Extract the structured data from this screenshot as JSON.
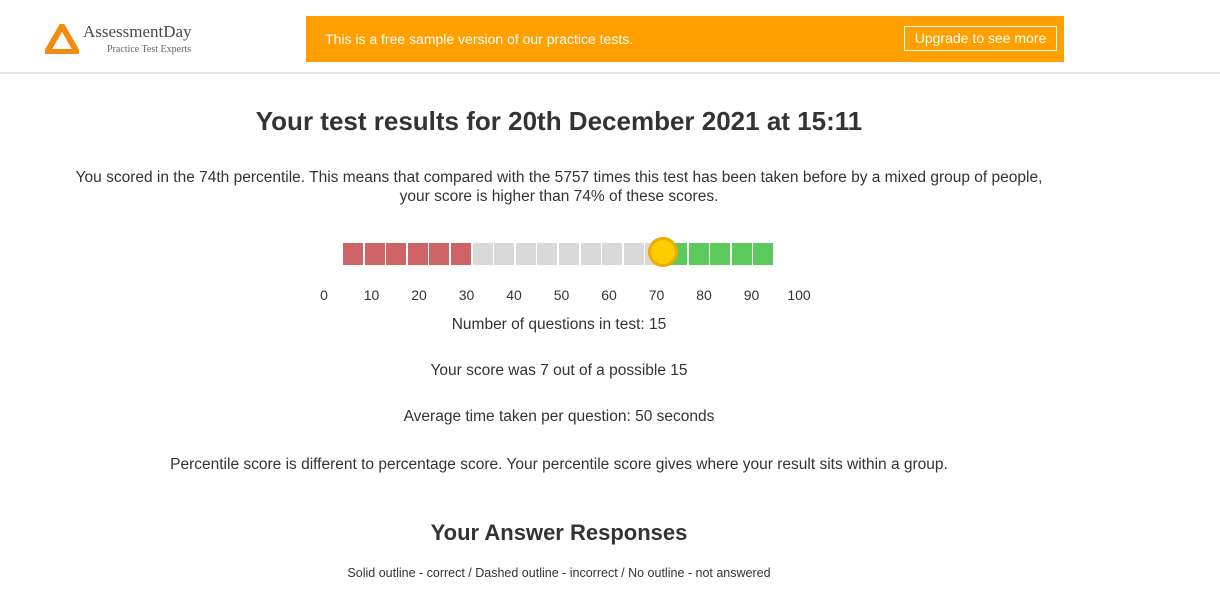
{
  "header": {
    "logo": {
      "name": "AssessmentDay",
      "tagline": "Practice Test Experts",
      "icon": "logo-triangle-icon",
      "color": "#f28c0f"
    },
    "banner": {
      "text": "This is a free sample version of our practice tests.",
      "button_label": "Upgrade to see more",
      "color": "#ff9f00"
    }
  },
  "results": {
    "title": "Your test results for 20th December 2021 at 15:11",
    "summary": "You scored in the 74th percentile. This means that compared with the 5757 times this test has been taken before by a mixed group of people, your score is higher than 74% of these scores.",
    "percentile": 74,
    "scale": {
      "ticks": [
        "0",
        "10",
        "20",
        "30",
        "40",
        "50",
        "60",
        "70",
        "80",
        "90",
        "100"
      ],
      "segments": [
        "low",
        "low",
        "low",
        "low",
        "low",
        "low",
        "mid",
        "mid",
        "mid",
        "mid",
        "mid",
        "mid",
        "mid",
        "mid",
        "mid",
        "high",
        "high",
        "high",
        "high",
        "high"
      ],
      "colors": {
        "low": "#cf6466",
        "mid": "#d9d9d9",
        "high": "#5cc95c",
        "marker": "#ffcc00",
        "marker_border": "#f2a900"
      }
    },
    "questions_line": "Number of questions in test: 15",
    "score_line": "Your score was 7 out of a possible 15",
    "time_line": "Average time taken per question: 50 seconds",
    "percentile_note": "Percentile score is different to percentage score. Your percentile score gives where your result sits within a group."
  },
  "responses": {
    "heading": "Your Answer Responses",
    "legend": "Solid outline - correct / Dashed outline - incorrect / No outline - not answered"
  }
}
